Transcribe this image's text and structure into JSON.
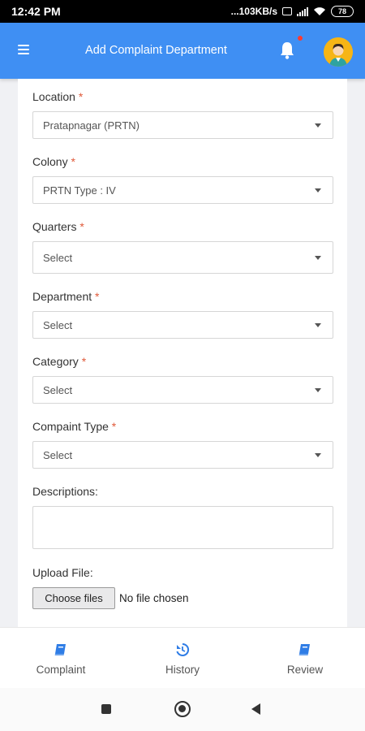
{
  "status_bar": {
    "time": "12:42 PM",
    "network_speed": "...103KB/s",
    "battery": "78"
  },
  "app_bar": {
    "title": "Add Complaint Department",
    "menu_icon": "menu-icon",
    "notification_icon": "bell-icon",
    "profile_icon": "avatar"
  },
  "form": {
    "location": {
      "label": "Location",
      "required": "*",
      "value": "Pratapnagar (PRTN)"
    },
    "colony": {
      "label": "Colony",
      "required": "*",
      "value": "PRTN Type : IV"
    },
    "quarters": {
      "label": "Quarters",
      "required": "*",
      "value": "Select"
    },
    "department": {
      "label": "Department",
      "required": "*",
      "value": "Select"
    },
    "category": {
      "label": "Category",
      "required": "*",
      "value": "Select"
    },
    "complaint_type": {
      "label": "Compaint Type",
      "required": "*",
      "value": "Select"
    },
    "descriptions": {
      "label": "Descriptions:",
      "value": ""
    },
    "upload": {
      "label": "Upload File:",
      "button": "Choose files",
      "status": "No file chosen"
    }
  },
  "bottom_nav": {
    "items": [
      {
        "label": "Complaint",
        "icon": "book-icon"
      },
      {
        "label": "History",
        "icon": "history-icon"
      },
      {
        "label": "Review",
        "icon": "book-icon"
      }
    ]
  },
  "colors": {
    "primary": "#3f8ff3",
    "required": "#e05a3a",
    "nav_icon": "#2f7de6"
  }
}
